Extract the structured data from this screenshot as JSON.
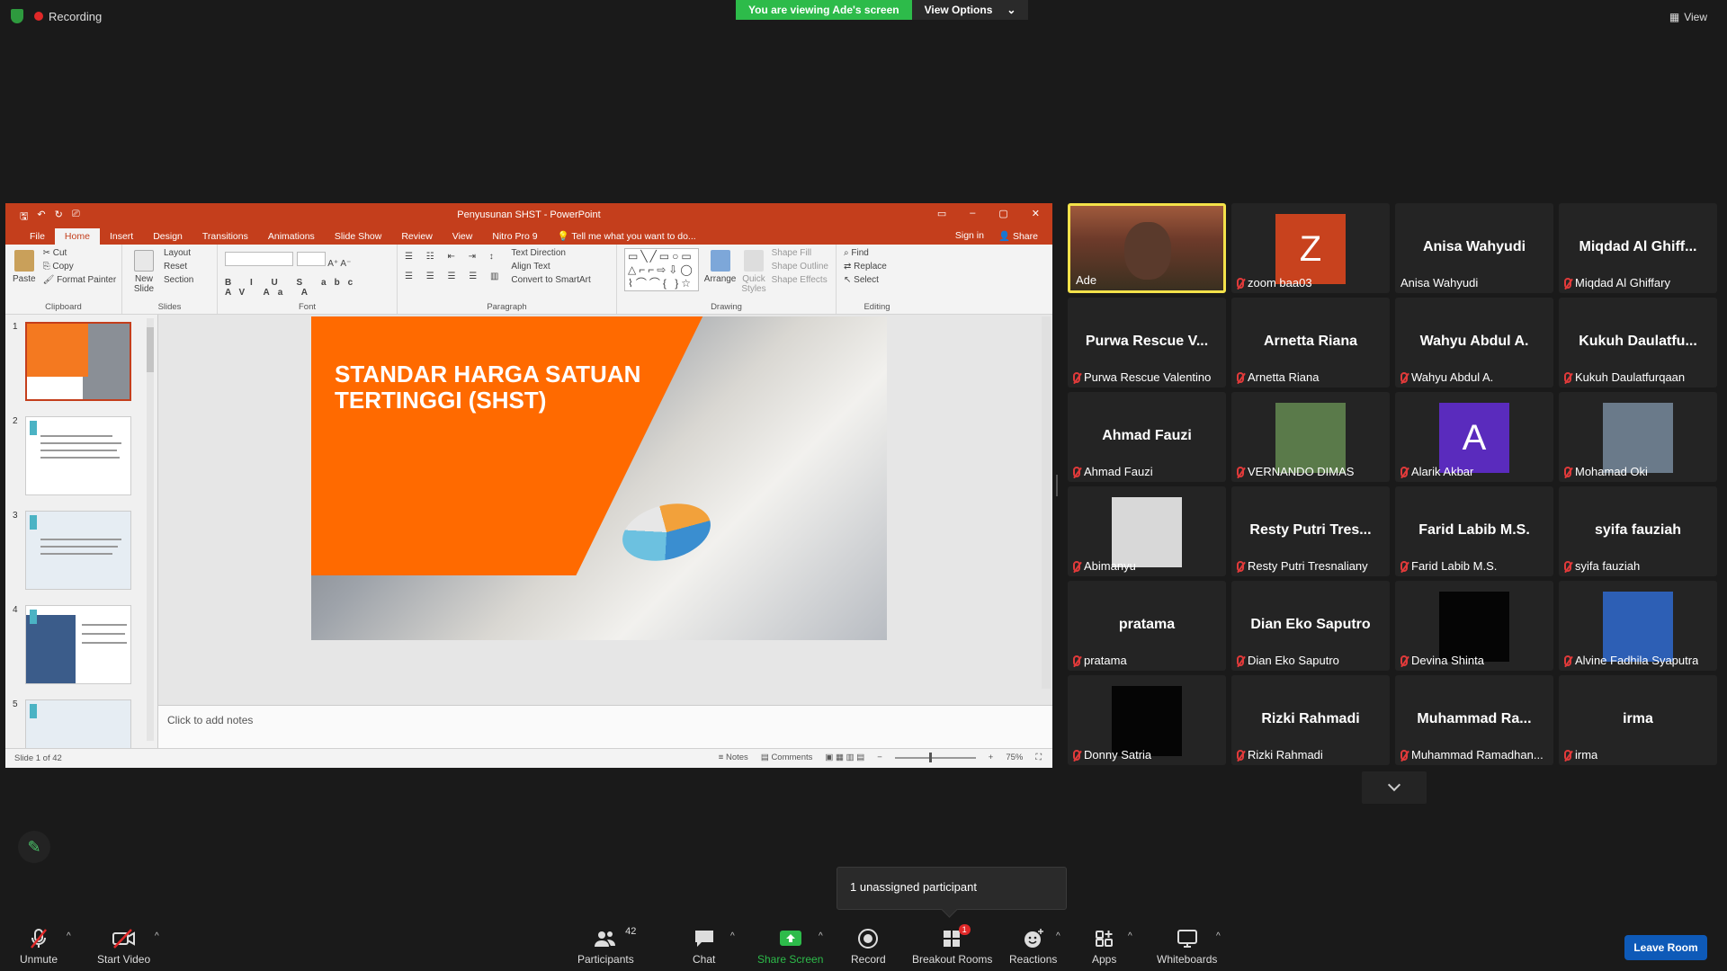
{
  "topbar": {
    "recording_label": "Recording",
    "viewing_banner": "You are viewing Ade's screen",
    "view_options_label": "View Options",
    "view_label": "View"
  },
  "ppt": {
    "window_title": "Penyusunan SHST - PowerPoint",
    "tabs": [
      "File",
      "Home",
      "Insert",
      "Design",
      "Transitions",
      "Animations",
      "Slide Show",
      "Review",
      "View",
      "Nitro Pro 9"
    ],
    "tell_me": "Tell me what you want to do...",
    "sign_in": "Sign in",
    "share": "Share",
    "ribbon": {
      "paste": "Paste",
      "cut": "Cut",
      "copy": "Copy",
      "format_painter": "Format Painter",
      "clipboard": "Clipboard",
      "new_slide": "New Slide",
      "layout": "Layout",
      "reset": "Reset",
      "section": "Section",
      "slides": "Slides",
      "font": "Font",
      "text_direction": "Text Direction",
      "align_text": "Align Text",
      "convert_smartart": "Convert to SmartArt",
      "paragraph": "Paragraph",
      "arrange": "Arrange",
      "quick_styles": "Quick Styles",
      "shape_fill": "Shape Fill",
      "shape_outline": "Shape Outline",
      "shape_effects": "Shape Effects",
      "drawing": "Drawing",
      "find": "Find",
      "replace": "Replace",
      "select": "Select",
      "editing": "Editing"
    },
    "thumb_numbers": [
      "1",
      "2",
      "3",
      "4",
      "5"
    ],
    "slide_title": "STANDAR HARGA SATUAN TERTINGGI (SHST)",
    "notes_placeholder": "Click to add notes",
    "status_slide": "Slide 1 of 42",
    "status_notes": "Notes",
    "status_comments": "Comments",
    "zoom": "75%"
  },
  "participants": [
    {
      "big": "",
      "small": "Ade",
      "muted": false,
      "active": true,
      "avatar": "video"
    },
    {
      "big": "",
      "small": "zoom baa03",
      "muted": true,
      "avatar": "letter",
      "letter": "Z",
      "color": "#c8421e"
    },
    {
      "big": "Anisa Wahyudi",
      "small": "Anisa Wahyudi",
      "muted": false
    },
    {
      "big": "Miqdad Al Ghiff...",
      "small": "Miqdad Al Ghiffary",
      "muted": true
    },
    {
      "big": "Purwa Rescue V...",
      "small": "Purwa Rescue Valentino",
      "muted": true
    },
    {
      "big": "Arnetta Riana",
      "small": "Arnetta Riana",
      "muted": true
    },
    {
      "big": "Wahyu Abdul A.",
      "small": "Wahyu Abdul A.",
      "muted": true
    },
    {
      "big": "Kukuh  Daulatfu...",
      "small": "Kukuh Daulatfurqaan",
      "muted": true
    },
    {
      "big": "Ahmad Fauzi",
      "small": "Ahmad Fauzi",
      "muted": true
    },
    {
      "big": "",
      "small": "VERNANDO DIMAS",
      "muted": true,
      "avatar": "photo",
      "color": "#5a7a4a"
    },
    {
      "big": "",
      "small": "Alarik Akbar",
      "muted": true,
      "avatar": "letter",
      "letter": "A",
      "color": "#5a2bbd"
    },
    {
      "big": "",
      "small": "Mohamad Oki",
      "muted": true,
      "avatar": "photo",
      "color": "#6a7a8a"
    },
    {
      "big": "",
      "small": "Abimanyu",
      "muted": true,
      "avatar": "photo",
      "color": "#d8d8d8"
    },
    {
      "big": "Resty Putri Tres...",
      "small": "Resty Putri Tresnaliany",
      "muted": true
    },
    {
      "big": "Farid Labib M.S.",
      "small": "Farid Labib M.S.",
      "muted": true
    },
    {
      "big": "syifa fauziah",
      "small": "syifa fauziah",
      "muted": true
    },
    {
      "big": "pratama",
      "small": "pratama",
      "muted": true
    },
    {
      "big": "Dian Eko Saputro",
      "small": "Dian Eko Saputro",
      "muted": true
    },
    {
      "big": "",
      "small": "Devina Shinta",
      "muted": true,
      "avatar": "photo",
      "color": "#050505"
    },
    {
      "big": "",
      "small": "Alvine Fadhila Syaputra",
      "muted": true,
      "avatar": "photo",
      "color": "#2d5fb5"
    },
    {
      "big": "",
      "small": "Donny Satria",
      "muted": true,
      "avatar": "photo",
      "color": "#050505"
    },
    {
      "big": "Rizki Rahmadi",
      "small": "Rizki Rahmadi",
      "muted": true
    },
    {
      "big": "Muhammad  Ra...",
      "small": "Muhammad Ramadhan...",
      "muted": true
    },
    {
      "big": "irma",
      "small": "irma",
      "muted": true
    }
  ],
  "tooltip": "1 unassigned participant",
  "toolbar": {
    "unmute": "Unmute",
    "start_video": "Start Video",
    "participants": "Participants",
    "participants_count": "42",
    "chat": "Chat",
    "share_screen": "Share Screen",
    "record": "Record",
    "breakout_rooms": "Breakout Rooms",
    "breakout_badge": "1",
    "reactions": "Reactions",
    "apps": "Apps",
    "whiteboards": "Whiteboards",
    "leave_room": "Leave Room"
  },
  "colors": {
    "ppt_accent": "#c43e1c",
    "zoom_green": "#2dbb4a",
    "leave_blue": "#0e5ab8",
    "active_speaker": "#f4e24a",
    "slide_orange": "#ff6a00"
  }
}
